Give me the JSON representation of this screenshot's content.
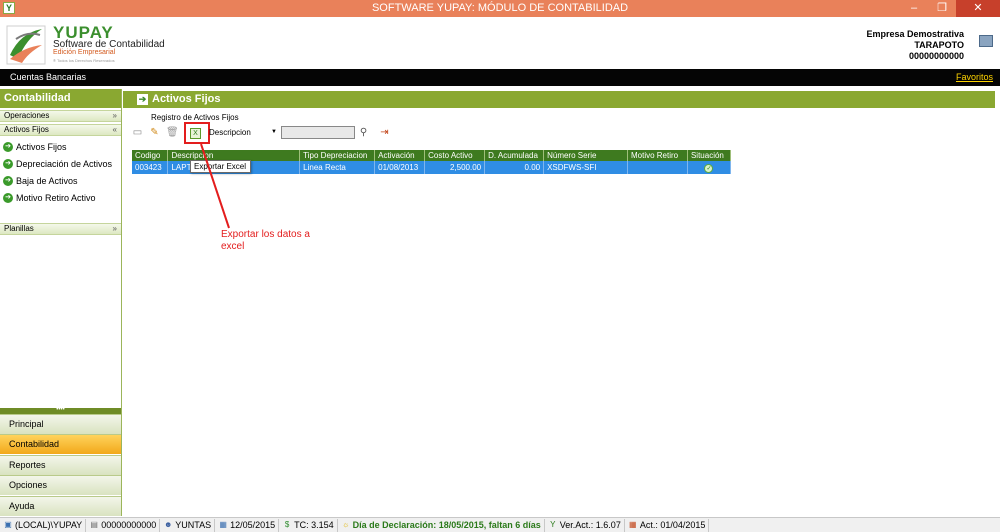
{
  "window": {
    "title": "SOFTWARE YUPAY: MÓDULO DE CONTABILIDAD",
    "minimize": "–",
    "restore": "❐",
    "close": "✕"
  },
  "header": {
    "logo_name": "YUPAY",
    "logo_subtitle": "Software de Contabilidad",
    "logo_edition": "Edición Empresarial",
    "logo_rights": "® Todos los Derechos Reservados",
    "company_name": "Empresa Demostrativa",
    "company_city": "TARAPOTO",
    "company_ruc": "00000000000"
  },
  "topbar": {
    "bank_accounts": "Cuentas Bancarias",
    "favorites": "Favoritos"
  },
  "sidebar": {
    "title": "Contabilidad",
    "sections": {
      "operaciones": "Operaciones",
      "activos_fijos": "Activos Fijos",
      "planillas": "Planillas"
    },
    "items": [
      "Activos Fijos",
      "Depreciación de Activos",
      "Baja de Activos",
      "Motivo Retiro Activo"
    ],
    "splitter": "••••",
    "modules": [
      "Principal",
      "Contabilidad",
      "Reportes",
      "Opciones",
      "Ayuda"
    ]
  },
  "main": {
    "title": "Activos Fijos",
    "subtitle": "Registro de Activos Fijos",
    "filter_field": "Descripcion",
    "search_value": ""
  },
  "table": {
    "columns": [
      "Codigo",
      "Descripcion",
      "Tipo Depreciacion",
      "Activación",
      "Costo Activo",
      "D. Acumulada",
      "Número Serie",
      "Motivo Retiro",
      "Situación"
    ],
    "rows": [
      {
        "codigo": "003423",
        "descripcion": "LAPTOP",
        "tipo": "Linea Recta",
        "activacion": "01/08/2013",
        "costo": "2,500.00",
        "acumulada": "0.00",
        "serie": "XSDFWS-SFI",
        "motivo": "",
        "situacion": "ok"
      }
    ]
  },
  "tooltip": "Exportar Excel",
  "annotation": "Exportar los datos a excel",
  "status": {
    "server": "(LOCAL)\\YUPAY",
    "ruc": "00000000000",
    "user": "YUNTAS",
    "date": "12/05/2015",
    "tc": "TC: 3.154",
    "declaration": "Día de Declaración: 18/05/2015, faltan 6 días",
    "version": "Ver.Act.: 1.6.07",
    "act": "Act.: 01/04/2015"
  }
}
